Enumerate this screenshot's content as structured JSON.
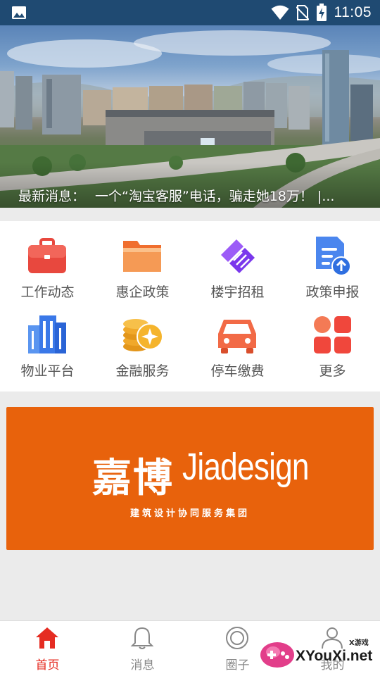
{
  "status_bar": {
    "time": "11:05",
    "icons": [
      "gallery-icon",
      "wifi-icon",
      "no-sim-icon",
      "battery-charging-icon"
    ]
  },
  "banner": {
    "news_prefix": "最新消息：",
    "news_text": "一个“淘宝客服”电话，骗走她18万！ |..."
  },
  "menu": {
    "items": [
      {
        "label": "工作动态",
        "icon": "briefcase-icon",
        "color": "#e8483e"
      },
      {
        "label": "惠企政策",
        "icon": "folder-icon",
        "color": "#f07a3a"
      },
      {
        "label": "楼宇招租",
        "icon": "handshake-icon",
        "color": "#8a4ff0"
      },
      {
        "label": "政策申报",
        "icon": "document-upload-icon",
        "color": "#3d7fe6"
      },
      {
        "label": "物业平台",
        "icon": "building-icon",
        "color": "#3d7fe6"
      },
      {
        "label": "金融服务",
        "icon": "coins-icon",
        "color": "#f0a020"
      },
      {
        "label": "停车缴费",
        "icon": "car-icon",
        "color": "#f06040"
      },
      {
        "label": "更多",
        "icon": "more-grid-icon",
        "color": "#f05040"
      }
    ]
  },
  "ad": {
    "brand_cn": "嘉博",
    "brand_en": "Jiadesign",
    "subtitle": "建筑设计协同服务集团",
    "background": "#e8620c"
  },
  "bottom_nav": {
    "tabs": [
      {
        "label": "首页",
        "icon": "home-icon",
        "active": true
      },
      {
        "label": "消息",
        "icon": "bell-icon",
        "active": false
      },
      {
        "label": "圈子",
        "icon": "circle-icon",
        "active": false
      },
      {
        "label": "我的",
        "icon": "user-icon",
        "active": false
      }
    ],
    "active_color": "#e52c22",
    "inactive_color": "#888888"
  },
  "watermark": {
    "text": "XYouXi.net",
    "small_text": "X游戏"
  }
}
